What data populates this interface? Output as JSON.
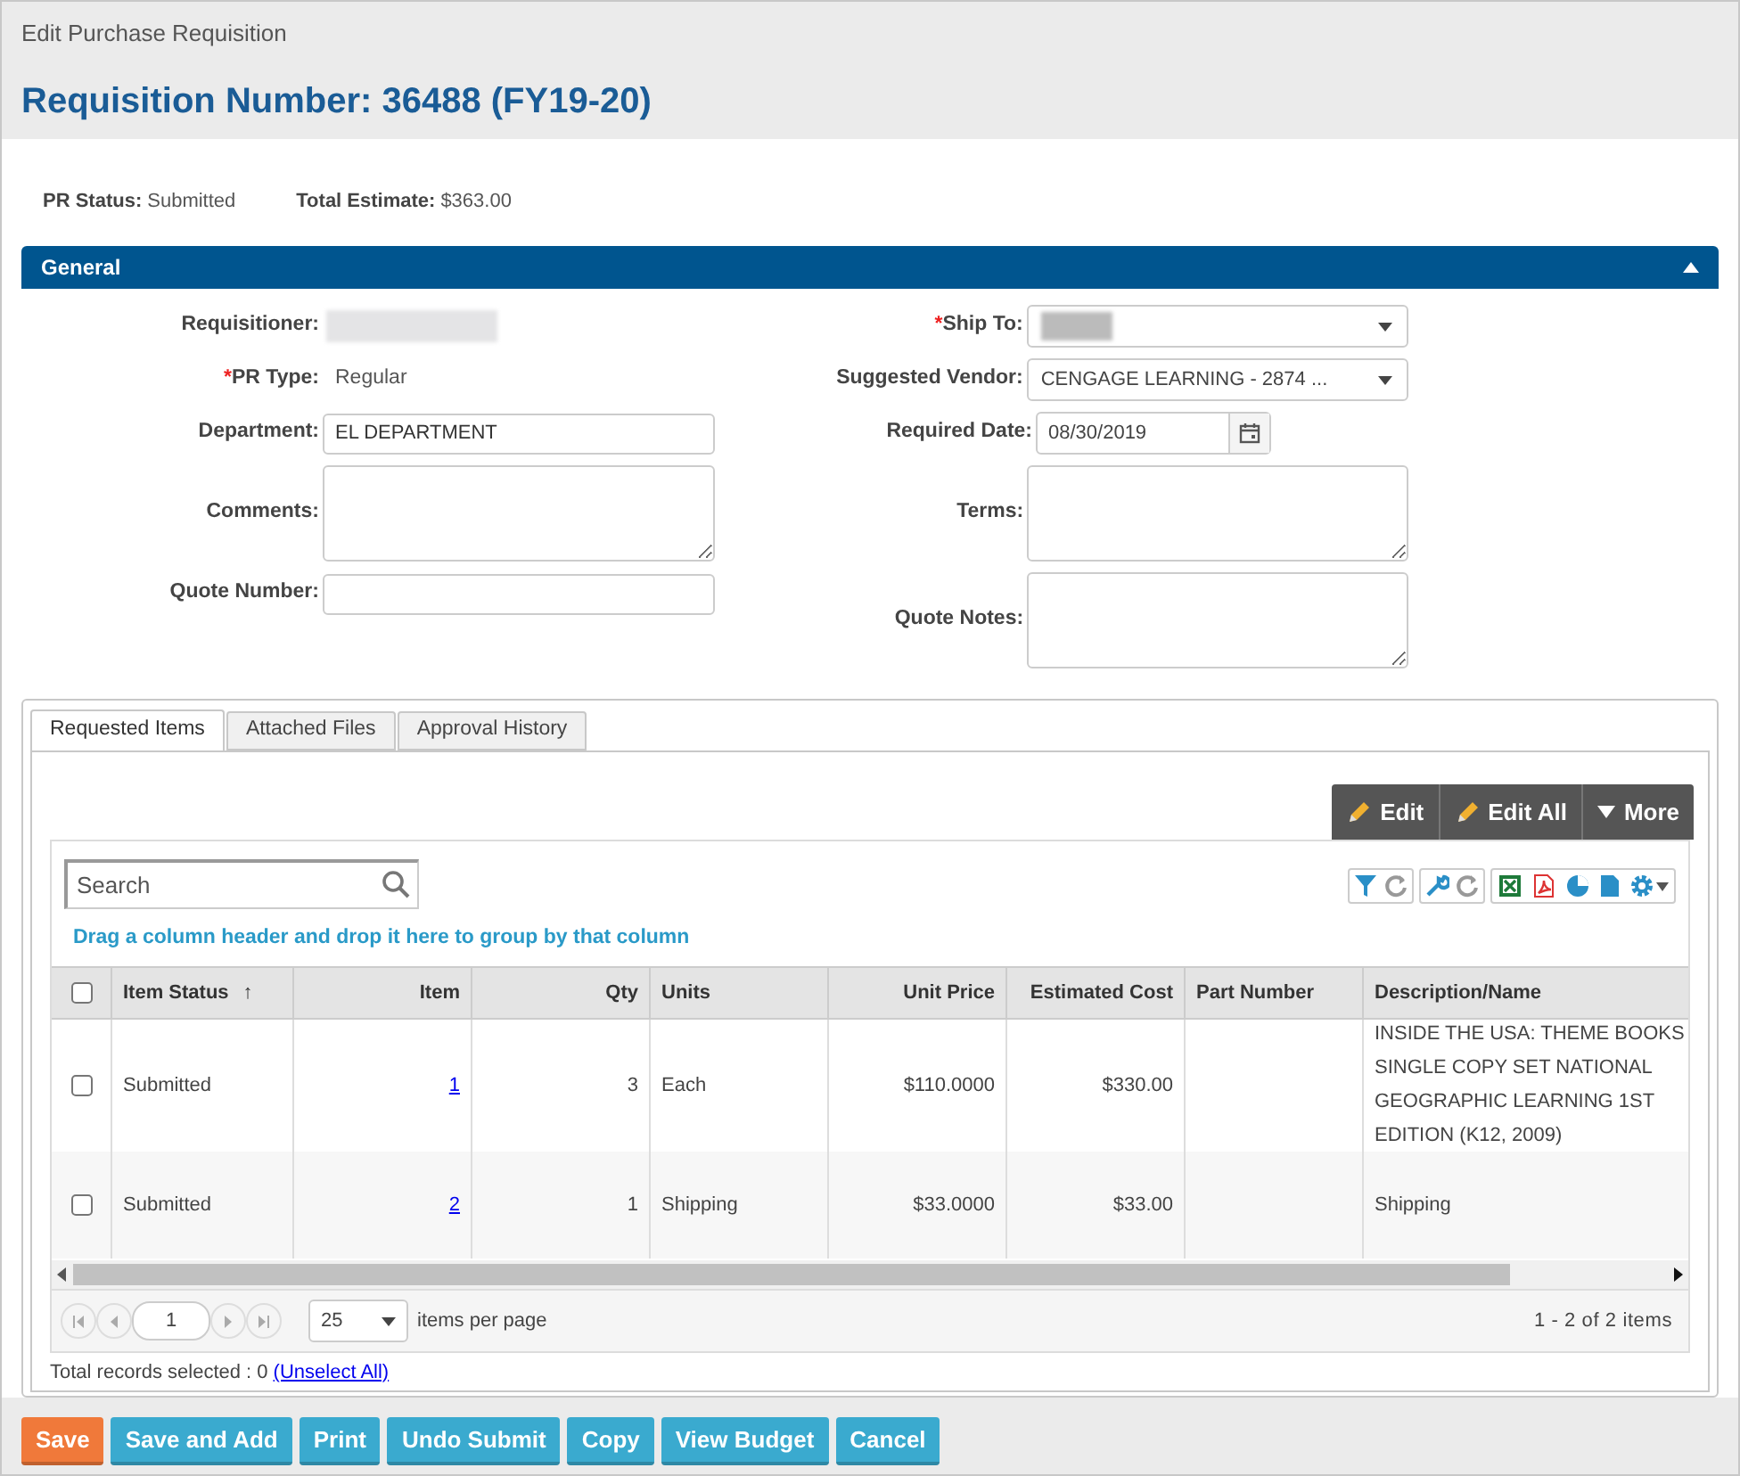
{
  "window": {
    "title": "Edit Purchase Requisition"
  },
  "heading": "Requisition Number: 36488 (FY19-20)",
  "summary": [
    {
      "label": "PR Status:",
      "value": "Submitted"
    },
    {
      "label": "Total Estimate:",
      "value": "$363.00"
    }
  ],
  "section": {
    "title": "General",
    "expanded": true
  },
  "form": {
    "left": [
      {
        "kind": "redacted",
        "label": "Requisitioner:"
      },
      {
        "kind": "static",
        "label": "PR Type:",
        "required_mark": "*",
        "value": "Regular"
      },
      {
        "kind": "input",
        "label": "Department:",
        "value": "EL DEPARTMENT"
      },
      {
        "kind": "textarea",
        "label": "Comments:"
      },
      {
        "kind": "input",
        "label": "Quote Number:"
      }
    ],
    "right": [
      {
        "kind": "select-redacted",
        "label": "Ship To:",
        "required_mark": "*"
      },
      {
        "kind": "select",
        "label": "Suggested Vendor:",
        "value": "CENGAGE LEARNING -  2874 ..."
      },
      {
        "kind": "date",
        "label": "Required Date:",
        "value": "08/30/2019"
      },
      {
        "kind": "textarea",
        "label": "Terms:"
      },
      {
        "kind": "textarea",
        "label": "Quote Notes:"
      }
    ]
  },
  "tabs": [
    {
      "label": "Requested Items",
      "selected": true
    },
    {
      "label": "Attached Files",
      "selected": false
    },
    {
      "label": "Approval History",
      "selected": false
    }
  ],
  "toolbar": [
    {
      "kind": "pencil",
      "label": "Edit"
    },
    {
      "kind": "pencil",
      "label": "Edit All"
    },
    {
      "kind": "caret",
      "label": "More"
    }
  ],
  "search": {
    "placeholder": "Search"
  },
  "group_hint": "Drag a column header and drop it here to group by that column",
  "table": {
    "all_selected": false,
    "columns": [
      {
        "label": "Item Status",
        "sort_indicator": "↑"
      },
      {
        "label": "Item"
      },
      {
        "label": "Qty"
      },
      {
        "label": "Units"
      },
      {
        "label": "Unit Price"
      },
      {
        "label": "Estimated Cost"
      },
      {
        "label": "Part Number"
      },
      {
        "label": "Description/Name"
      }
    ],
    "rows": [
      {
        "selected": false,
        "cells": [
          "Submitted",
          "1",
          "3",
          "Each",
          "$110.0000",
          "$330.00",
          "",
          "INSIDE THE USA: THEME BOOKS SINGLE COPY SET NATIONAL GEOGRAPHIC LEARNING 1ST EDITION (K12, 2009)"
        ]
      },
      {
        "selected": false,
        "cells": [
          "Submitted",
          "2",
          "1",
          "Shipping",
          "$33.0000",
          "$33.00",
          "",
          "Shipping"
        ]
      }
    ]
  },
  "pager": {
    "page": "1",
    "page_size": "25",
    "page_size_label": "items per page",
    "range": "1 - 2 of 2 items"
  },
  "selection": {
    "text": "Total records selected : 0",
    "link": "(Unselect All)"
  },
  "buttons": [
    {
      "label": "Save",
      "kind": "primary"
    },
    {
      "label": "Save and Add",
      "kind": "default"
    },
    {
      "label": "Print",
      "kind": "default"
    },
    {
      "label": "Undo Submit",
      "kind": "default"
    },
    {
      "label": "Copy",
      "kind": "default"
    },
    {
      "label": "View Budget",
      "kind": "default"
    },
    {
      "label": "Cancel",
      "kind": "default"
    }
  ]
}
